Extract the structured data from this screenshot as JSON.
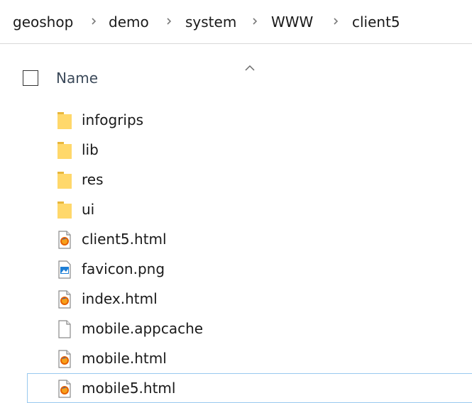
{
  "breadcrumb": [
    "geoshop",
    "demo",
    "system",
    "WWW",
    "client5"
  ],
  "header": {
    "name_label": "Name"
  },
  "files": [
    {
      "name": "infogrips",
      "type": "folder"
    },
    {
      "name": "lib",
      "type": "folder"
    },
    {
      "name": "res",
      "type": "folder"
    },
    {
      "name": "ui",
      "type": "folder"
    },
    {
      "name": "client5.html",
      "type": "firefox-html"
    },
    {
      "name": "favicon.png",
      "type": "image"
    },
    {
      "name": "index.html",
      "type": "firefox-html"
    },
    {
      "name": "mobile.appcache",
      "type": "blank-file"
    },
    {
      "name": "mobile.html",
      "type": "firefox-html"
    },
    {
      "name": "mobile5.html",
      "type": "firefox-html"
    }
  ],
  "focused_item": "mobile5.html",
  "colors": {
    "folder": "#ffd86b",
    "folder_edge": "#e8b73c",
    "focus_border": "#99c9ef",
    "header_text": "#3c4a5a"
  }
}
